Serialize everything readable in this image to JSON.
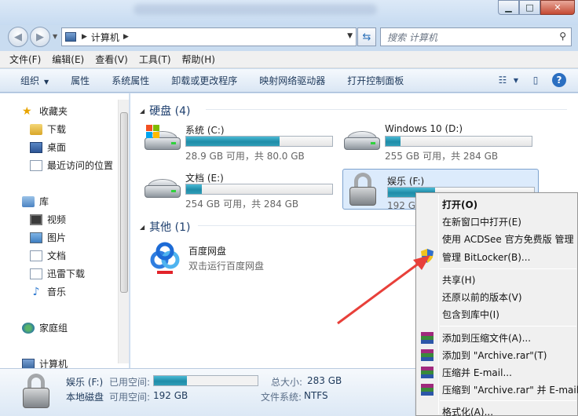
{
  "address": {
    "crumb": "计算机",
    "search_placeholder": "搜索 计算机"
  },
  "menubar": [
    "文件(F)",
    "编辑(E)",
    "查看(V)",
    "工具(T)",
    "帮助(H)"
  ],
  "toolbar": {
    "organize": "组织",
    "items": [
      "属性",
      "系统属性",
      "卸载或更改程序",
      "映射网络驱动器",
      "打开控制面板"
    ]
  },
  "nav": {
    "favorites": "收藏夹",
    "downloads": "下载",
    "desktop": "桌面",
    "recent": "最近访问的位置",
    "libraries": "库",
    "videos": "视频",
    "pictures": "图片",
    "documents": "文档",
    "thunder": "迅雷下载",
    "music": "音乐",
    "homegroup": "家庭组",
    "computer": "计算机"
  },
  "groups": {
    "hard_disks": "硬盘 (4)",
    "other": "其他 (1)"
  },
  "drives": [
    {
      "name": "系统 (C:)",
      "info": "28.9 GB 可用，共 80.0 GB",
      "used_fraction": 0.64
    },
    {
      "name": "Windows 10 (D:)",
      "info": "255 GB 可用，共 284 GB",
      "used_fraction": 0.1
    },
    {
      "name": "文档 (E:)",
      "info": "254 GB 可用，共 284 GB",
      "used_fraction": 0.11
    },
    {
      "name": "娱乐 (F:)",
      "info": "192 G",
      "used_fraction": 0.32
    }
  ],
  "app": {
    "name": "百度网盘",
    "desc": "双击运行百度网盘"
  },
  "details": {
    "name": "娱乐 (F:)",
    "type": "本地磁盘",
    "used_label": "已用空间:",
    "free_label": "可用空间:",
    "free_value": "192 GB",
    "total_label": "总大小:",
    "total_value": "283 GB",
    "fs_label": "文件系统:",
    "fs_value": "NTFS",
    "used_fraction": 0.32
  },
  "context_menu": {
    "open": "打开(O)",
    "open_new": "在新窗口中打开(E)",
    "acdsee": "使用 ACDSee 官方免费版 管理",
    "bitlocker": "管理 BitLocker(B)...",
    "share": "共享(H)",
    "restore": "还原以前的版本(V)",
    "include": "包含到库中(I)",
    "add_archive": "添加到压缩文件(A)...",
    "add_rar": "添加到 \"Archive.rar\"(T)",
    "compress_email": "压缩并 E-mail...",
    "compress_rar_email": "压缩到 \"Archive.rar\" 并 E-mail",
    "format": "格式化(A)..."
  },
  "colors": {
    "accent_arrow": "#e8403a",
    "bar_fill": "#1f8ca8"
  }
}
